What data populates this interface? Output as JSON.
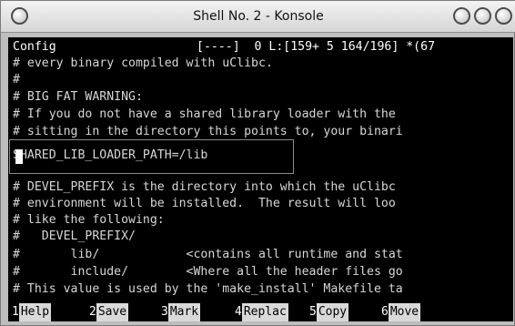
{
  "window": {
    "title": "Shell No. 2 - Konsole"
  },
  "terminal": {
    "status_left": "Config",
    "status_right": "[----]  0 L:[159+ 5 164/196] *(67",
    "lines": [
      "# every binary compiled with uClibc.",
      "#",
      "# BIG FAT WARNING:",
      "# If you do not have a shared library loader with the",
      "# sitting in the directory this points to, your binari",
      "SHARED_LIB_LOADER_PATH=/lib",
      "",
      "# DEVEL_PREFIX is the directory into which the uClibc",
      "# environment will be installed.  The result will loo",
      "# like the following:",
      "#   DEVEL_PREFIX/",
      "#       lib/            <contains all runtime and stat",
      "#       include/        <Where all the header files go",
      "# This value is used by the 'make_install' Makefile ta"
    ]
  },
  "function_keys": [
    {
      "num": "1",
      "label": "Help"
    },
    {
      "num": "2",
      "label": "Save"
    },
    {
      "num": "3",
      "label": "Mark"
    },
    {
      "num": "4",
      "label": "Replac"
    },
    {
      "num": "5",
      "label": "Copy"
    },
    {
      "num": "6",
      "label": "Move"
    }
  ]
}
